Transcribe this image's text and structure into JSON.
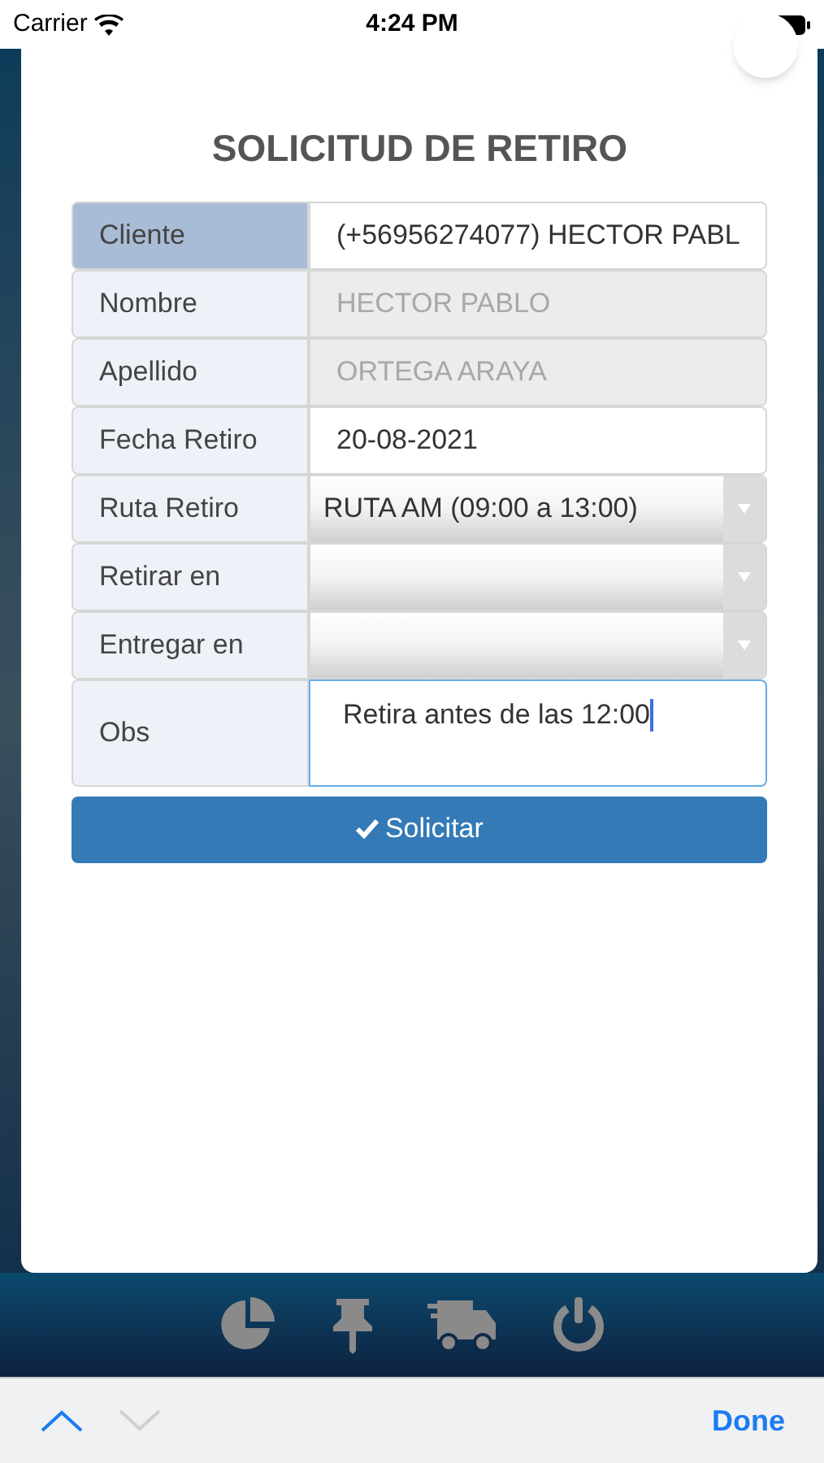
{
  "status_bar": {
    "carrier": "Carrier",
    "time": "4:24 PM"
  },
  "dialog": {
    "title": "SOLICITUD DE RETIRO",
    "rows": [
      {
        "label": "Cliente",
        "kind": "text",
        "value": "(+56956274077) HECTOR PABL",
        "highlighted": true,
        "disabled": false
      },
      {
        "label": "Nombre",
        "kind": "text",
        "value": "HECTOR PABLO",
        "highlighted": false,
        "disabled": true
      },
      {
        "label": "Apellido",
        "kind": "text",
        "value": "ORTEGA ARAYA",
        "highlighted": false,
        "disabled": true
      },
      {
        "label": "Fecha Retiro",
        "kind": "text",
        "value": "20-08-2021",
        "highlighted": false,
        "disabled": false
      },
      {
        "label": "Ruta Retiro",
        "kind": "select",
        "value": "RUTA AM (09:00 a 13:00)",
        "highlighted": false
      },
      {
        "label": "Retirar en",
        "kind": "select",
        "highlighted": false
      },
      {
        "label": "Entregar en",
        "kind": "select",
        "highlighted": false
      },
      {
        "label": "Obs",
        "kind": "textarea",
        "value": "Retira antes de las 12:00",
        "highlighted": false,
        "focused": true
      }
    ],
    "submit": "Solicitar"
  },
  "keyboard_toolbar": {
    "previous_enabled": true,
    "next_enabled": false,
    "done": "Done"
  }
}
